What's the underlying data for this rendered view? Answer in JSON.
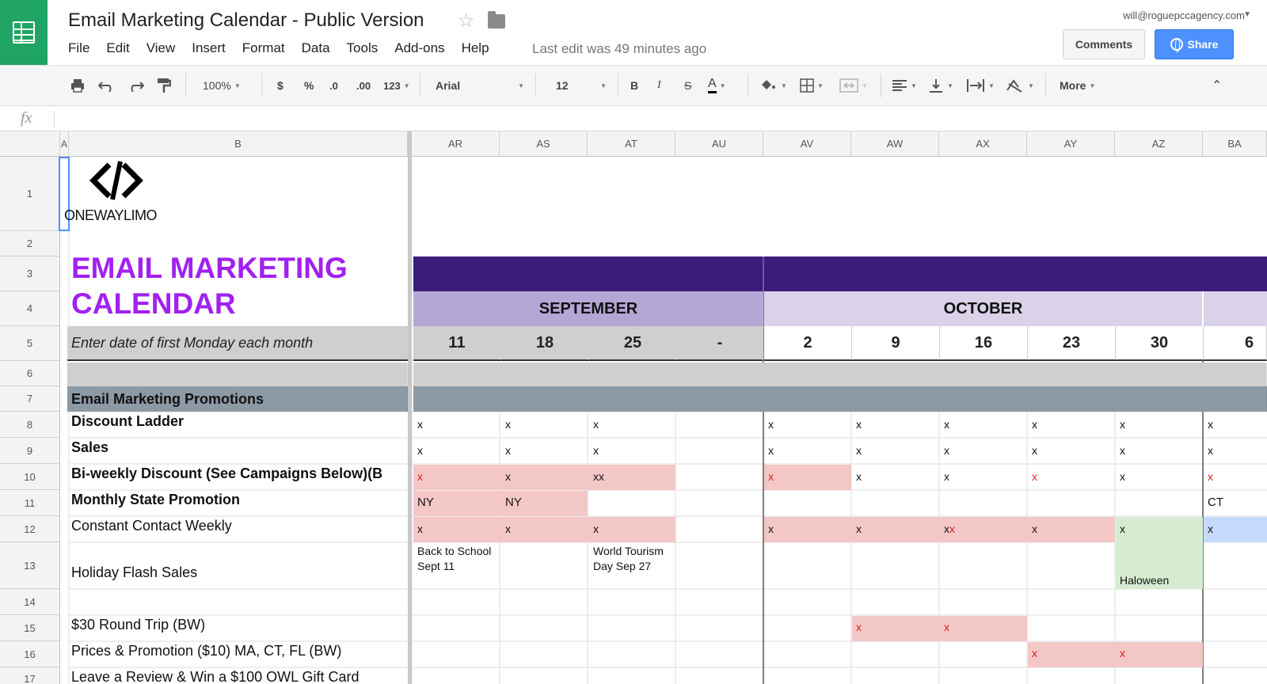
{
  "app": {
    "title": "Email Marketing Calendar - Public Version",
    "menu": [
      "File",
      "Edit",
      "View",
      "Insert",
      "Format",
      "Data",
      "Tools",
      "Add-ons",
      "Help"
    ],
    "last_edit": "Last edit was 49 minutes ago",
    "account": "will@roguepccagency.com",
    "comments_label": "Comments",
    "share_label": "Share"
  },
  "toolbar": {
    "zoom": "100%",
    "currency": "$",
    "percent": "%",
    "dec_less": ".0",
    "dec_more": ".00",
    "more_formats": "123",
    "font": "Arial",
    "font_size": "12",
    "bold": "B",
    "italic": "I",
    "strike": "S",
    "text_color": "A",
    "more": "More"
  },
  "formula": {
    "fx": "fx"
  },
  "columns": [
    "A",
    "B",
    "AR",
    "AS",
    "AT",
    "AU",
    "AV",
    "AW",
    "AX",
    "AY",
    "AZ",
    "BA"
  ],
  "rows": [
    "1",
    "2",
    "3",
    "4",
    "5",
    "6",
    "7",
    "8",
    "9",
    "10",
    "11",
    "12",
    "13",
    "14",
    "15",
    "16",
    "17"
  ],
  "sheet": {
    "logo_text": "ONEWAYLIMO",
    "heading_line1": "EMAIL MARKETING",
    "heading_line2": "CALENDAR",
    "date_hint": "Enter date of first Monday each month",
    "month_sep": "SEPTEMBER",
    "month_oct": "OCTOBER",
    "dates": [
      "11",
      "18",
      "25",
      "-",
      "2",
      "9",
      "16",
      "23",
      "30",
      "6"
    ],
    "section_title": "Email Marketing Promotions",
    "row_labels": [
      "Discount Ladder",
      "Sales",
      "Bi-weekly Discount (See Campaigns Below)(B",
      "Monthly State Promotion",
      "Constant Contact Weekly",
      "Holiday Flash Sales",
      "",
      "$30 Round Trip (BW)",
      "Prices & Promotion ($10)  MA, CT, FL (BW)",
      "Leave a Review & Win a $100 OWL Gift Card"
    ],
    "marks": {
      "x": "x",
      "xx": "xx",
      "ny": "NY",
      "ct": "CT"
    },
    "notes": {
      "back_to_school": "Back to School Sept 11",
      "world_tourism": "World Tourism Day Sep 27",
      "halloween": "Haloween"
    }
  },
  "colors": {
    "sheets_green": "#1fa463",
    "heading_purple": "#a121f0",
    "banner_dark": "#3b1c7a",
    "month_sep_bg": "#b4a7d6",
    "month_oct_bg": "#d9d2e9",
    "section_slate": "#8c9aa6",
    "pink": "#f4c7c7",
    "green": "#d5ecd1",
    "blue": "#c6dafc",
    "share_blue": "#4d90fe"
  }
}
